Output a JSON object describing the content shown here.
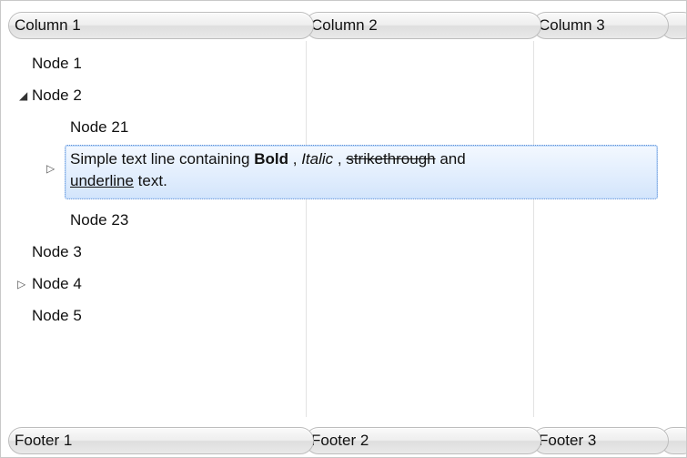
{
  "columns": [
    "Column 1",
    "Column 2",
    "Column 3",
    ""
  ],
  "footers": [
    "Footer 1",
    "Footer 2",
    "Footer 3",
    ""
  ],
  "nodes": {
    "node1": "Node 1",
    "node2": "Node 2",
    "node21": "Node 21",
    "node23": "Node 23",
    "node3": "Node 3",
    "node4": "Node 4",
    "node5": "Node 5"
  },
  "selected_node": {
    "part1": "Simple text line containing ",
    "bold": "Bold",
    "sep1": " , ",
    "italic": "Italic",
    "sep2": " , ",
    "strike": "strikethrough",
    "part2": " and",
    "underline": "underline",
    "part3": " text."
  },
  "glyphs": {
    "expanded": "◢",
    "collapsed": "▷"
  }
}
